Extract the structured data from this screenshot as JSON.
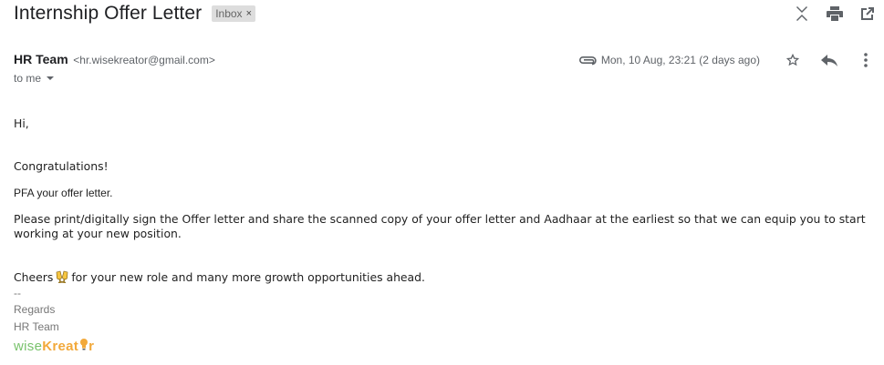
{
  "email": {
    "subject": "Internship Offer Letter",
    "label": "Inbox",
    "label_remove": "×",
    "sender_name": "HR Team",
    "sender_email": "<hr.wisekreator@gmail.com>",
    "recipient": "to me",
    "date": "Mon, 10 Aug, 23:21 (2 days ago)"
  },
  "icons": {
    "top": [
      "expand-collapse-icon",
      "print-icon",
      "open-in-new-window-icon"
    ],
    "meta": [
      "attachment-icon",
      "star-icon",
      "reply-icon",
      "more-options-icon"
    ]
  },
  "body": {
    "greeting": "Hi,",
    "congrats": "Congratulations!",
    "pfa": "PFA your offer letter.",
    "instructions": "Please print/digitally sign the Offer letter and share the scanned copy of your offer letter and Aadhaar at the earliest so that we can equip you to start working at your new position.",
    "cheers_before": "Cheers",
    "cheers_after": "for your new role and many more growth opportunities ahead.",
    "sig_sep": "--",
    "regards": "Regards",
    "sig_name": "HR Team",
    "logo_wise": "wise",
    "logo_kreat": "Kreat",
    "logo_tail": "r"
  },
  "colors": {
    "logo_green": "#78c26b",
    "logo_orange": "#f2a93b",
    "icon_grey": "#5f6368"
  }
}
